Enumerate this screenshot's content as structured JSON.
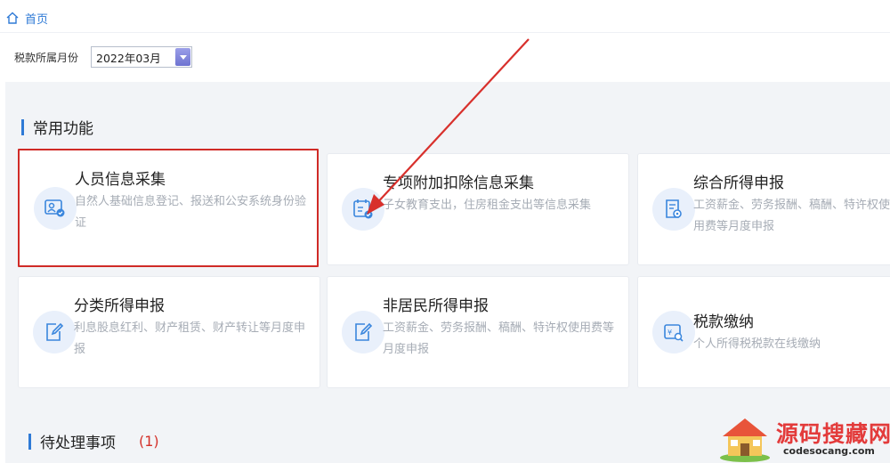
{
  "breadcrumb": {
    "home_label": "首页"
  },
  "filter": {
    "label": "税款所属月份",
    "value": "2022年03月"
  },
  "sections": {
    "common": {
      "title": "常用功能"
    },
    "pending": {
      "title": "待处理事项",
      "count": "(1)"
    }
  },
  "cards": [
    {
      "title": "人员信息采集",
      "desc": "自然人基础信息登记、报送和公安系统身份验证",
      "icon": "id-card-icon"
    },
    {
      "title": "专项附加扣除信息采集",
      "desc": "子女教育支出，住房租金支出等信息采集",
      "icon": "tax-calendar-icon"
    },
    {
      "title": "综合所得申报",
      "desc": "工资薪金、劳务报酬、稿酬、特许权使用费等月度申报",
      "icon": "tax-form-icon"
    },
    {
      "title": "分类所得申报",
      "desc": "利息股息红利、财产租赁、财产转让等月度申报",
      "icon": "edit-form-icon"
    },
    {
      "title": "非居民所得申报",
      "desc": "工资薪金、劳务报酬、稿酬、特许权使用费等月度申报",
      "icon": "edit-form-icon"
    },
    {
      "title": "税款缴纳",
      "desc": "个人所得税税款在线缴纳",
      "icon": "tax-payment-icon"
    }
  ],
  "colors": {
    "accent": "#2f7ad6",
    "highlight": "#d02b27",
    "panel_bg": "#f2f4f7"
  },
  "watermark": {
    "cn": "源码搜藏网",
    "en": "codesocang.com"
  }
}
